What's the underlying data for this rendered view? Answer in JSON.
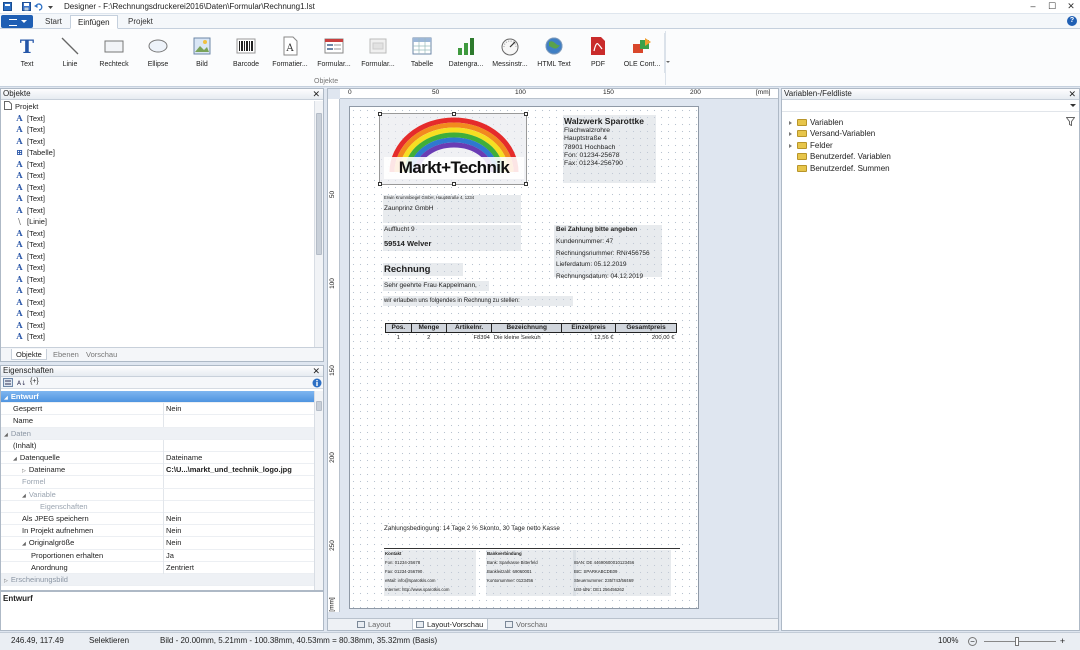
{
  "window": {
    "title": "Designer - F:\\Rechnungsdruckerei2016\\Daten\\Formular\\Rechnung1.lst",
    "controls": [
      "–",
      "☐",
      "✕"
    ]
  },
  "tabs": [
    {
      "label": "Start"
    },
    {
      "label": "Einfügen",
      "active": true
    },
    {
      "label": "Projekt"
    }
  ],
  "ribbon": {
    "group_label": "Objekte",
    "buttons": [
      {
        "label": "Text",
        "icon": "text-icon"
      },
      {
        "label": "Linie",
        "icon": "line-icon"
      },
      {
        "label": "Rechteck",
        "icon": "rectangle-icon"
      },
      {
        "label": "Ellipse",
        "icon": "ellipse-icon"
      },
      {
        "label": "Bild",
        "icon": "image-icon"
      },
      {
        "label": "Barcode",
        "icon": "barcode-icon"
      },
      {
        "label": "Formatier...",
        "icon": "formatted-text-icon"
      },
      {
        "label": "Formular...",
        "icon": "form-control-icon"
      },
      {
        "label": "Formular...",
        "icon": "form-element-icon"
      },
      {
        "label": "Tabelle",
        "icon": "table-icon"
      },
      {
        "label": "Datengra...",
        "icon": "chart-icon"
      },
      {
        "label": "Messinstr...",
        "icon": "gauge-icon"
      },
      {
        "label": "HTML Text",
        "icon": "html-globe-icon"
      },
      {
        "label": "PDF",
        "icon": "pdf-icon"
      },
      {
        "label": "OLE Cont...",
        "icon": "ole-icon"
      }
    ]
  },
  "objects_panel": {
    "title": "Objekte",
    "root": "Projekt",
    "items": [
      {
        "label": "[Text]",
        "glyph": "A"
      },
      {
        "label": "[Text]",
        "glyph": "A"
      },
      {
        "label": "[Text]",
        "glyph": "A"
      },
      {
        "label": "[Tabelle]",
        "glyph": "⊞"
      },
      {
        "label": "[Text]",
        "glyph": "A"
      },
      {
        "label": "[Text]",
        "glyph": "A"
      },
      {
        "label": "[Text]",
        "glyph": "A"
      },
      {
        "label": "[Text]",
        "glyph": "A"
      },
      {
        "label": "[Text]",
        "glyph": "A"
      },
      {
        "label": "[Linie]",
        "glyph": "\\"
      },
      {
        "label": "[Text]",
        "glyph": "A"
      },
      {
        "label": "[Text]",
        "glyph": "A"
      },
      {
        "label": "[Text]",
        "glyph": "A"
      },
      {
        "label": "[Text]",
        "glyph": "A"
      },
      {
        "label": "[Text]",
        "glyph": "A"
      },
      {
        "label": "[Text]",
        "glyph": "A"
      },
      {
        "label": "[Text]",
        "glyph": "A"
      },
      {
        "label": "[Text]",
        "glyph": "A"
      },
      {
        "label": "[Text]",
        "glyph": "A"
      },
      {
        "label": "[Text]",
        "glyph": "A"
      }
    ],
    "subtabs": [
      "Objekte",
      "Ebenen",
      "Vorschau"
    ]
  },
  "properties_panel": {
    "title": "Eigenschaften",
    "sort_label": "{+}",
    "rows": [
      {
        "key": "Entwurf",
        "value": "",
        "type": "sel",
        "indent": 0,
        "expander": "◢"
      },
      {
        "key": "Gesperrt",
        "value": "Nein",
        "type": "",
        "indent": 1
      },
      {
        "key": "Name",
        "value": "",
        "type": "",
        "indent": 1
      },
      {
        "key": "Daten",
        "value": "",
        "type": "cat",
        "indent": 0,
        "expander": "◢"
      },
      {
        "key": "(Inhalt)",
        "value": "",
        "type": "",
        "indent": 1
      },
      {
        "key": "Datenquelle",
        "value": "Dateiname",
        "type": "",
        "indent": 1,
        "expander": "◢"
      },
      {
        "key": "Dateiname",
        "value": "C:\\U...\\markt_und_technik_logo.jpg",
        "type": "bold",
        "indent": 2,
        "expander": "▷"
      },
      {
        "key": "Formel",
        "value": "",
        "type": "dis",
        "indent": 2
      },
      {
        "key": "Variable",
        "value": "",
        "type": "dis",
        "indent": 2,
        "expander": "◢"
      },
      {
        "key": "Eigenschaften",
        "value": "",
        "type": "dis",
        "indent": 4
      },
      {
        "key": "Als JPEG speichern",
        "value": "Nein",
        "type": "",
        "indent": 2
      },
      {
        "key": "In Projekt aufnehmen",
        "value": "Nein",
        "type": "",
        "indent": 2
      },
      {
        "key": "Originalgröße",
        "value": "Nein",
        "type": "",
        "indent": 2,
        "expander": "◢"
      },
      {
        "key": "Proportionen erhalten",
        "value": "Ja",
        "type": "",
        "indent": 3
      },
      {
        "key": "Anordnung",
        "value": "Zentriert",
        "type": "",
        "indent": 3
      },
      {
        "key": "Erscheinungsbild",
        "value": "",
        "type": "cat",
        "indent": 0,
        "expander": "▷"
      }
    ],
    "description": "Entwurf"
  },
  "ruler": {
    "unit": "[mm]",
    "top_labels": [
      "0",
      "50",
      "100",
      "150",
      "200"
    ],
    "left_labels": [
      "50",
      "100",
      "150",
      "200",
      "250"
    ],
    "left_unit": "[mm]"
  },
  "invoice": {
    "logo_text": "Markt+Technik",
    "company_name": "Walzwerk Sparottke",
    "company_lines": [
      "Flachwalzrohre",
      "Hauptstraße 4",
      "78901 Hochbach",
      "Fon: 01234-25678",
      "Fax: 01234-256790"
    ],
    "sender_line": "Erwin Krummbiegel GmbH, Hauptstraße 4, 1234",
    "recipient": [
      "Zaunprinz GmbH",
      "Aufflucht 9",
      "59514 Welver"
    ],
    "payment_heading": "Bei Zahlung bitte angeben",
    "payment_lines": [
      "Kundennummer: 47",
      "Rechnungsnummer: RNr456756",
      "Lieferdatum: 05.12.2019",
      "Rechnungsdatum: 04.12.2019"
    ],
    "title": "Rechnung",
    "salutation": "Sehr geehrte Frau Kappelmann,",
    "intro": "wir erlauben uns folgendes in Rechnung zu stellen:",
    "table_headers": [
      "Pos.",
      "Menge",
      "Artikelnr.",
      "Bezeichnung",
      "Einzelpreis",
      "Gesamtpreis"
    ],
    "table_rows": [
      [
        "1",
        "2",
        "F8394",
        "Die kleine Seekuh",
        "12,56 €",
        "200,00 €"
      ]
    ],
    "terms": "Zahlungsbedingung: 14 Tage 2 % Skonto, 30 Tage netto Kasse",
    "footer": {
      "contact_heading": "Kontakt",
      "contact_lines": [
        "Fon: 01234-25678",
        "Fax: 01234-256790",
        "eMail: info@sparotkis.com",
        "Internet: http://www.sparotkis.com"
      ],
      "bank_heading": "Bankverbindung",
      "bank_lines": [
        "Bank: Sparkasse Bitterfeld",
        "Bankleitzahl: 69060001",
        "Kontonummer: 0123456"
      ],
      "iban_lines": [
        "IBAN: DE 44690600010123456",
        "BIC: SPARKABCDE09",
        "Steuernummer: 235/743/56469",
        "USt-IdNr: DE1 256456262"
      ]
    }
  },
  "view_tabs": [
    {
      "label": "Layout"
    },
    {
      "label": "Layout-Vorschau",
      "active": true
    },
    {
      "label": "Vorschau"
    }
  ],
  "variables_panel": {
    "title": "Variablen-/Feldliste",
    "items": [
      {
        "label": "Variablen",
        "expandable": true
      },
      {
        "label": "Versand-Variablen",
        "expandable": true
      },
      {
        "label": "Felder",
        "expandable": true
      },
      {
        "label": "Benutzerdef. Variablen",
        "expandable": false
      },
      {
        "label": "Benutzerdef. Summen",
        "expandable": false
      }
    ]
  },
  "status": {
    "coords": "246.49, 117.49",
    "mode": "Selektieren",
    "info": "Bild  -  20.00mm, 5.21mm  -  100.38mm, 40.53mm  =  80.38mm, 35.32mm (Basis)",
    "zoom": "100%",
    "zoom_level": 1.0
  }
}
